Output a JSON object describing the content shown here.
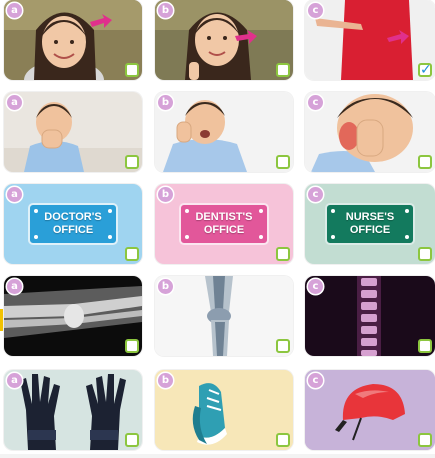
{
  "colors": {
    "badge": "#d6a2d8",
    "checkbox_border": "#8cc63f",
    "checkmark": "#1e8fd8"
  },
  "rows": [
    {
      "options": [
        {
          "letter": "a",
          "scene": "girl-hair",
          "checked": false
        },
        {
          "letter": "b",
          "scene": "girl-mouth",
          "checked": false
        },
        {
          "letter": "c",
          "scene": "woman-waist",
          "checked": true,
          "check_glyph": "✓"
        }
      ]
    },
    {
      "options": [
        {
          "letter": "a",
          "scene": "boy-cough",
          "checked": false
        },
        {
          "letter": "b",
          "scene": "boy-toothache",
          "checked": false
        },
        {
          "letter": "c",
          "scene": "boy-earache",
          "checked": false
        }
      ]
    },
    {
      "options": [
        {
          "letter": "a",
          "sign_line1": "DOCTOR'S",
          "sign_line2": "OFFICE",
          "checked": false
        },
        {
          "letter": "b",
          "sign_line1": "DENTIST'S",
          "sign_line2": "OFFICE",
          "checked": false
        },
        {
          "letter": "c",
          "sign_line1": "NURSE'S",
          "sign_line2": "OFFICE",
          "checked": false
        }
      ]
    },
    {
      "options": [
        {
          "letter": "a",
          "scene": "xray-arm",
          "checked": false
        },
        {
          "letter": "b",
          "scene": "xray-knee",
          "checked": false
        },
        {
          "letter": "c",
          "scene": "xray-spine",
          "checked": false
        }
      ]
    },
    {
      "options": [
        {
          "letter": "a",
          "scene": "gloves",
          "checked": false
        },
        {
          "letter": "b",
          "scene": "sneakers",
          "checked": false
        },
        {
          "letter": "c",
          "scene": "helmet",
          "checked": false
        }
      ]
    }
  ]
}
